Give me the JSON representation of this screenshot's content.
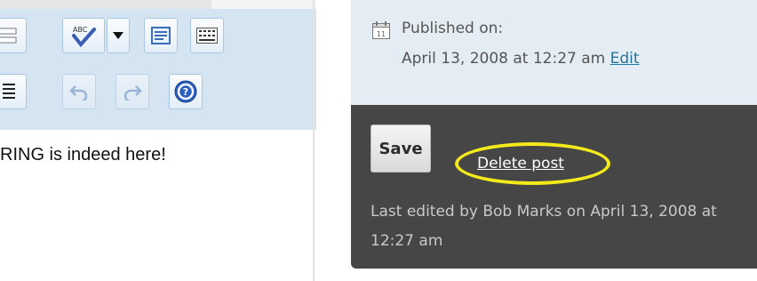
{
  "editor": {
    "content_text": "RING is indeed here!",
    "toolbar_row1": [
      {
        "icon": "insert-horizontal-rule-icon"
      },
      {
        "icon": "spellcheck-icon"
      },
      {
        "icon": "dropdown-arrow-icon"
      },
      {
        "icon": "text-box-icon"
      },
      {
        "icon": "character-map-icon"
      }
    ],
    "toolbar_row2": [
      {
        "icon": "indent-icon"
      },
      {
        "icon": "undo-icon",
        "disabled": true
      },
      {
        "icon": "redo-icon",
        "disabled": true
      },
      {
        "icon": "help-icon"
      }
    ],
    "toolbar_bg": "#d5e4f1"
  },
  "publish": {
    "published_label": "Published on:",
    "published_date": "April 13, 2008 at 12:27 am",
    "edit_link": "Edit",
    "save_label": "Save",
    "delete_label": "Delete post",
    "last_edited": "Last edited by Bob Marks on April 13, 2008 at 12:27 am",
    "colors": {
      "panel_light": "#e4edf4",
      "panel_dark": "#464646",
      "link": "#21759b",
      "highlight": "#f4ea1a"
    }
  }
}
